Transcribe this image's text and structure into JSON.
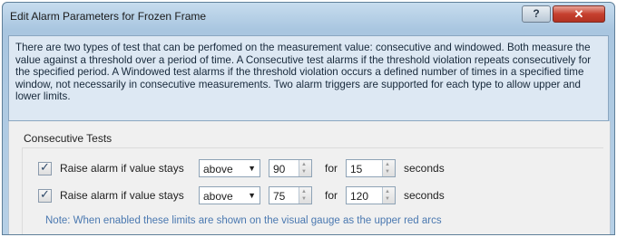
{
  "window": {
    "title": "Edit Alarm Parameters for Frozen Frame",
    "help_label": "?",
    "close_label": "✕"
  },
  "info": {
    "text": "There are two types of test that can be perfomed on the measurement value: consecutive and windowed. Both measure the value against a threshold over a period of time. A Consecutive test alarms if the threshold violation repeats consecutively for the specified period.  A Windowed test alarms if the threshold violation occurs a defined number of times in a specified time window, not necessarily in consecutive measurements. Two alarm triggers are supported for each type to allow upper and lower limits."
  },
  "consecutive": {
    "group_label": "Consecutive Tests",
    "rows": [
      {
        "checked": true,
        "label": "Raise alarm if value stays",
        "condition": "above",
        "threshold": "90",
        "for_label": "for",
        "period": "15",
        "unit": "seconds"
      },
      {
        "checked": true,
        "label": "Raise alarm if value stays",
        "condition": "above",
        "threshold": "75",
        "for_label": "for",
        "period": "120",
        "unit": "seconds"
      }
    ],
    "note": "Note: When enabled these limits are shown on the visual gauge as the upper red arcs"
  },
  "icons": {
    "check": "check-mark-icon",
    "dropdown": "chevron-down-icon",
    "spin_up": "spin-up-icon",
    "spin_down": "spin-down-icon"
  },
  "colors": {
    "title_bar": "#a9c6e0",
    "close_button": "#c6402f",
    "info_background": "#dde8f3",
    "note_text": "#4a78b0"
  }
}
